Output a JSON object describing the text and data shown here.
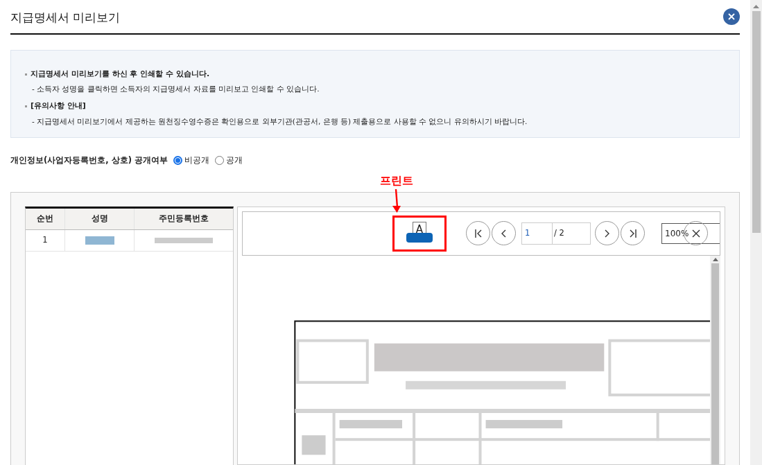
{
  "window": {
    "title": "지급명세서 미리보기"
  },
  "notices": [
    {
      "heading": "지급명세서 미리보기를 하신 후 인쇄할 수 있습니다.",
      "detail": "- 소득자 성명을 클릭하면 소득자의 지급명세서 자료를 미리보고 인쇄할 수 있습니다."
    },
    {
      "heading": "[유의사항 안내]",
      "detail": "- 지급명세서 미리보기에서 제공하는 원천징수영수증은 확인용으로 외부기관(관공서, 은행 등) 제출용으로 사용할 수 없으니 유의하시기 바랍니다."
    }
  ],
  "privacy": {
    "label": "개인정보(사업자등록번호, 상호) 공개여부",
    "options": [
      {
        "label": "비공개",
        "selected": true
      },
      {
        "label": "공개",
        "selected": false
      }
    ]
  },
  "table": {
    "columns": [
      "순번",
      "성명",
      "주민등록번호"
    ],
    "rows": [
      {
        "number": "1"
      }
    ]
  },
  "viewer": {
    "print_letter": "A",
    "page": "1",
    "total": "/ 2",
    "zoom": "100%"
  },
  "annotation": {
    "label": "프린트"
  }
}
